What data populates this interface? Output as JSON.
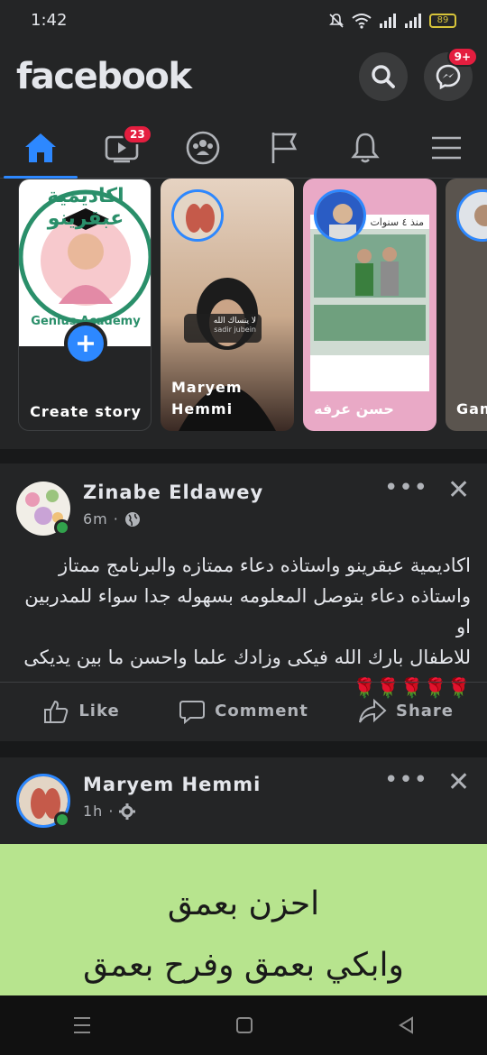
{
  "status": {
    "time": "1:42",
    "battery": "89"
  },
  "header": {
    "logo": "facebook",
    "messenger_badge": "9+"
  },
  "nav": {
    "video_badge": "23"
  },
  "stories": [
    {
      "name": "Create story",
      "type": "create",
      "banner_text": "اكاديمية عبقرينو",
      "ring_text": "Genius Academy"
    },
    {
      "name": "Maryem\nHemmi",
      "sticker_title": "لا ينساك الله",
      "sticker_sub": "sadir jubein"
    },
    {
      "name": "حسن عرفه",
      "time_label": "منذ ٤ سنوات"
    },
    {
      "name": "Gam"
    }
  ],
  "posts": [
    {
      "author": "Zinabe Eldawey",
      "time": "6m",
      "text_lines": [
        "اكاديمية عبقرينو واستاذه دعاء ممتازه  والبرنامج ممتاز",
        "واستاذه دعاء بتوصل المعلومه بسهوله جدا سواء للمدربين او",
        "للاطفال بارك الله فيكى  وزادك علما  واحسن ما بين يديكى",
        "🌹🌹🌹🌹🌹"
      ],
      "actions": {
        "like": "Like",
        "comment": "Comment",
        "share": "Share"
      }
    },
    {
      "author": "Maryem Hemmi",
      "time": "1h",
      "text_lines": [
        "احزن بعمق",
        "وابكي بعمق وفرح بعمق"
      ]
    }
  ],
  "colors": {
    "accent": "#2d88ff",
    "badge": "#e41e3f",
    "online": "#31a24c",
    "green_post": "#b7e48e"
  }
}
